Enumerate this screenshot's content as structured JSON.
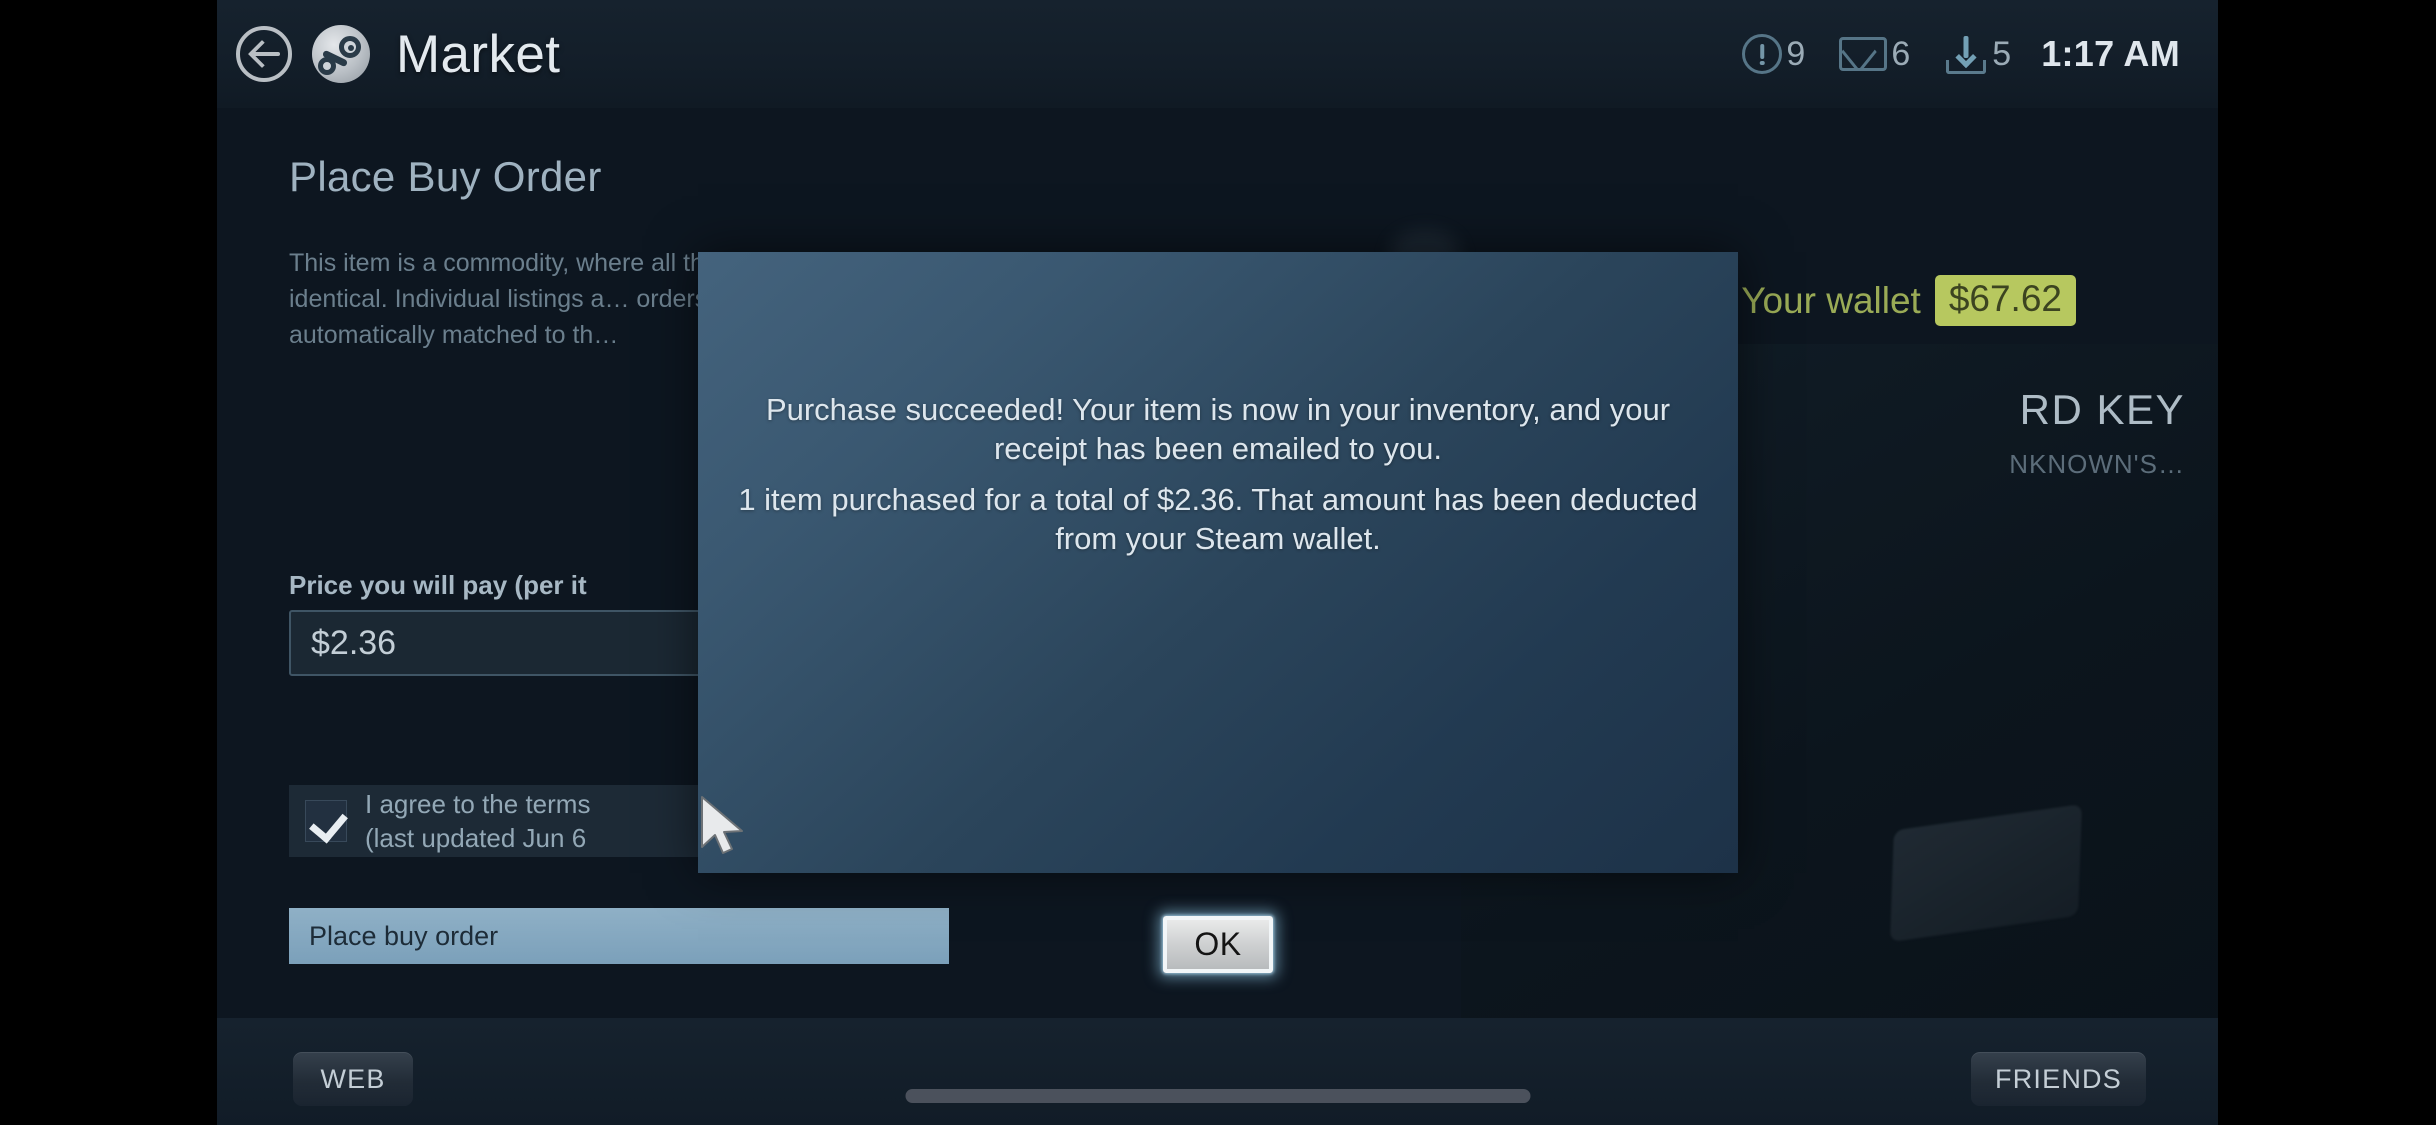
{
  "header": {
    "title": "Market",
    "back_icon": "back-arrow-icon",
    "logo_icon": "steam-logo-icon",
    "status": [
      {
        "icon": "alert-icon",
        "count": "9"
      },
      {
        "icon": "mail-icon",
        "count": "6"
      },
      {
        "icon": "download-icon",
        "count": "5"
      }
    ],
    "clock": "1:17 AM"
  },
  "background_page": {
    "heading": "Place Buy Order",
    "description": "This item is a commodity, where all the individual items are effectively identical. Individual listings a… orders to buy at a specific pr… automatically matched to th…",
    "price_label": "Price you will pay (per it",
    "price_value": "$2.36",
    "agree_line1": "I agree to the terms",
    "agree_line2": "(last updated Jun 6",
    "place_order_label": "Place buy order",
    "wallet_label": "Your wallet",
    "wallet_amount": "$67.62",
    "item_title": "RD KEY",
    "item_subtitle": "NKNOWN'S…"
  },
  "modal": {
    "paragraph1": "Purchase succeeded! Your item is now in your inventory, and your receipt has been emailed to you.",
    "paragraph2": "1 item purchased for a total of $2.36. That amount has been deducted from your Steam wallet.",
    "ok_label": "OK"
  },
  "bottom_bar": {
    "web_label": "WEB",
    "friends_label": "FRIENDS"
  },
  "colors": {
    "wallet_green": "#b7c85f",
    "modal_top": "#44637d",
    "modal_bottom": "#1d3248",
    "accent_button": "#8fb0c6"
  }
}
